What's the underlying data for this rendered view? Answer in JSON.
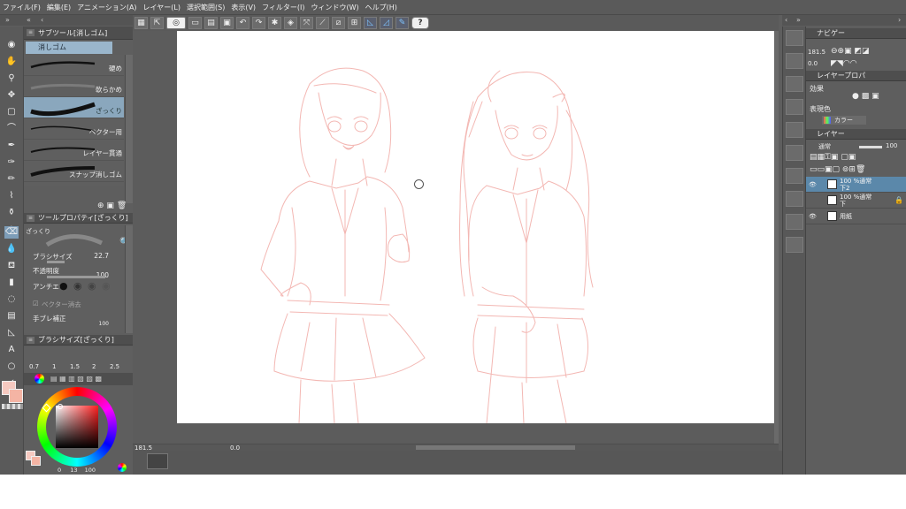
{
  "menu": {
    "items": [
      "ファイル(F)",
      "編集(E)",
      "アニメーション(A)",
      "レイヤー(L)",
      "選択範囲(S)",
      "表示(V)",
      "フィルター(I)",
      "ウィンドウ(W)",
      "ヘルプ(H)"
    ]
  },
  "subtool_panel": {
    "title": "サブツール[消しゴム]",
    "active_tab": "消しゴム",
    "brushes": [
      {
        "label": "硬め",
        "selected": false
      },
      {
        "label": "軟らかめ",
        "selected": false
      },
      {
        "label": "ざっくり",
        "selected": true
      },
      {
        "label": "ベクター用",
        "selected": false
      },
      {
        "label": "レイヤー貫通",
        "selected": false
      },
      {
        "label": "スナップ消しゴム",
        "selected": false
      }
    ]
  },
  "tool_property": {
    "title": "ツールプロパティ[ざっくり]",
    "preset_name": "ざっくり",
    "brush_size_label": "ブラシサイズ",
    "brush_size_value": "22.7",
    "opacity_label": "不透明度",
    "opacity_value": "100",
    "antialias_label": "アンチエイ",
    "vector_erase_label": "ベクター消去",
    "stabilize_label": "手ブレ補正",
    "stabilize_value": "100"
  },
  "brush_size_panel": {
    "title": "ブラシサイズ[ざっくり]",
    "sizes": [
      "0.7",
      "1",
      "1.5",
      "2",
      "2.5"
    ]
  },
  "color_panel": {
    "front_color": "#f6c9c0",
    "back_color": "#f4b4a4",
    "readout_a": "0",
    "readout_b": "13",
    "readout_c": "100"
  },
  "navigator": {
    "title": "ナビゲー",
    "zoom": "181.5",
    "rotation": "0.0"
  },
  "layer_property": {
    "title": "レイヤープロパ",
    "effect_label": "効果",
    "expression_label": "表現色",
    "expression_value": "カラー"
  },
  "layer_panel": {
    "title": "レイヤー",
    "blend_mode": "通常",
    "opacity": "100",
    "layers": [
      {
        "line1": "100 %通常",
        "line2": "下2",
        "selected": true
      },
      {
        "line1": "100 %通常",
        "line2": "下",
        "selected": false
      },
      {
        "line1": "用紙",
        "line2": "",
        "selected": false
      }
    ]
  },
  "status": {
    "zoom": "181.5",
    "rotation": "0.0"
  },
  "colors": {
    "sketch_line": "#f2b0ab",
    "selected_blue": "#5b88aa",
    "panel_bg": "#5e5e5e"
  }
}
